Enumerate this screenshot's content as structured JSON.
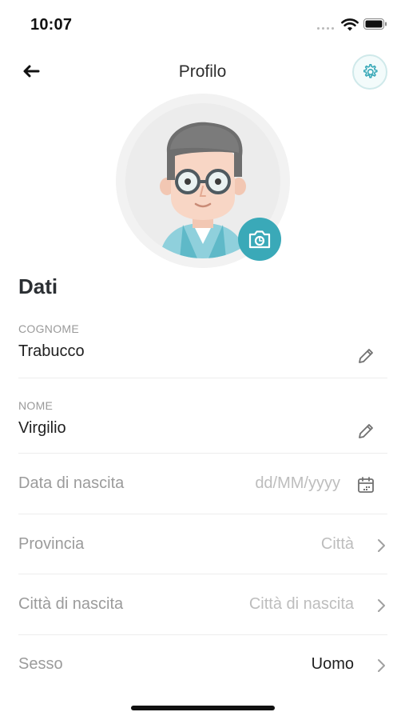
{
  "status_bar": {
    "time": "10:07"
  },
  "header": {
    "title": "Profilo"
  },
  "section": {
    "title": "Dati"
  },
  "fields": {
    "cognome": {
      "label": "COGNOME",
      "value": "Trabucco"
    },
    "nome": {
      "label": "NOME",
      "value": "Virgilio"
    }
  },
  "rows": {
    "data_nascita": {
      "label": "Data di nascita",
      "placeholder": "dd/MM/yyyy"
    },
    "provincia": {
      "label": "Provincia",
      "placeholder": "Città"
    },
    "citta_nascita": {
      "label": "Città di nascita",
      "placeholder": "Città di nascita"
    },
    "sesso": {
      "label": "Sesso",
      "value": "Uomo"
    }
  },
  "icons": {
    "back": "arrow-left-icon",
    "settings": "gear-icon",
    "camera": "camera-icon",
    "edit": "pencil-icon",
    "calendar": "calendar-icon",
    "chevron": "chevron-right-icon"
  },
  "colors": {
    "accent": "#3aa9b8",
    "label_gray": "#9b9b9b",
    "placeholder_gray": "#bdbdbd"
  }
}
